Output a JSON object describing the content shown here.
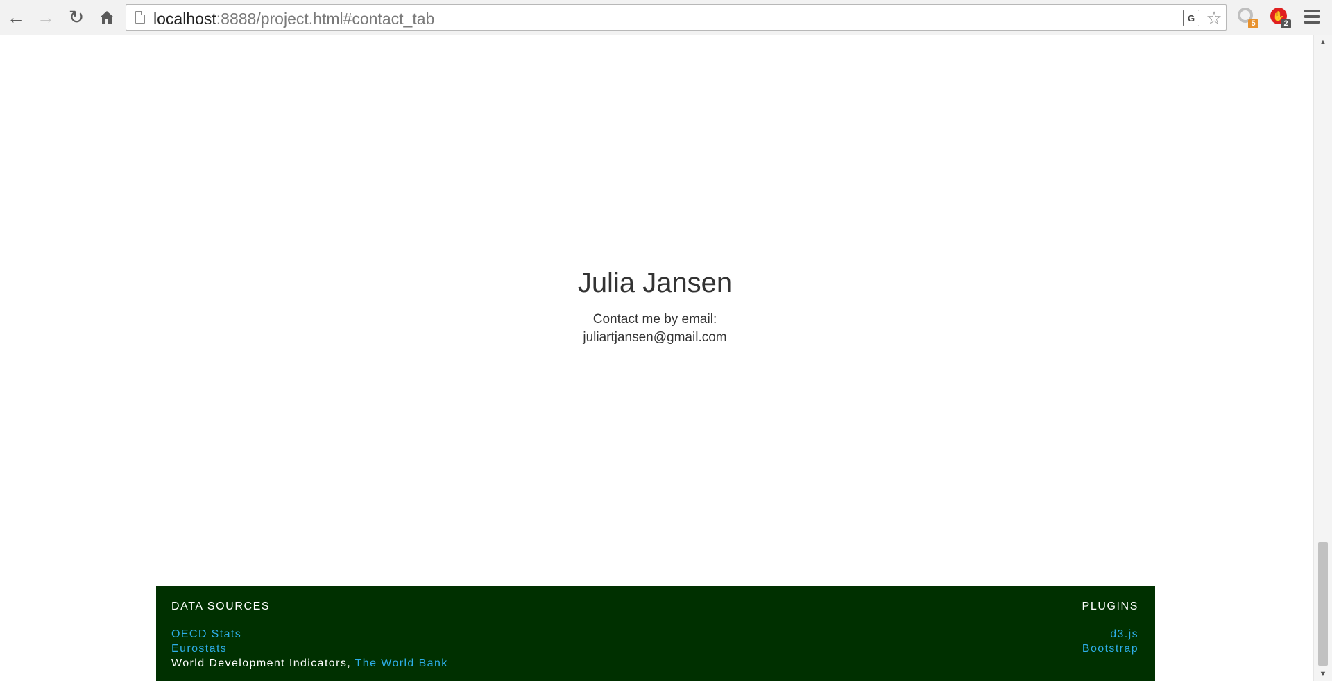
{
  "browser": {
    "url_host": "localhost",
    "url_rest": ":8888/project.html#contact_tab",
    "translate_icon_label": "G",
    "extensions": [
      {
        "name": "ring-extension",
        "badge": "5",
        "badge_color": "#e8922e"
      },
      {
        "name": "adblock-extension",
        "badge": "2",
        "badge_color": "#555555"
      }
    ]
  },
  "contact": {
    "name": "Julia Jansen",
    "prompt": "Contact me by email:",
    "email": "juliartjansen@gmail.com"
  },
  "footer": {
    "background": "#003000",
    "link_color": "#2eaee8",
    "data_sources": {
      "heading": "DATA SOURCES",
      "links": [
        "OECD Stats",
        "Eurostats"
      ],
      "wdi_text": "World Development Indicators, ",
      "wdi_link": "The World Bank"
    },
    "plugins": {
      "heading": "PLUGINS",
      "links": [
        "d3.js",
        "Bootstrap"
      ]
    }
  }
}
